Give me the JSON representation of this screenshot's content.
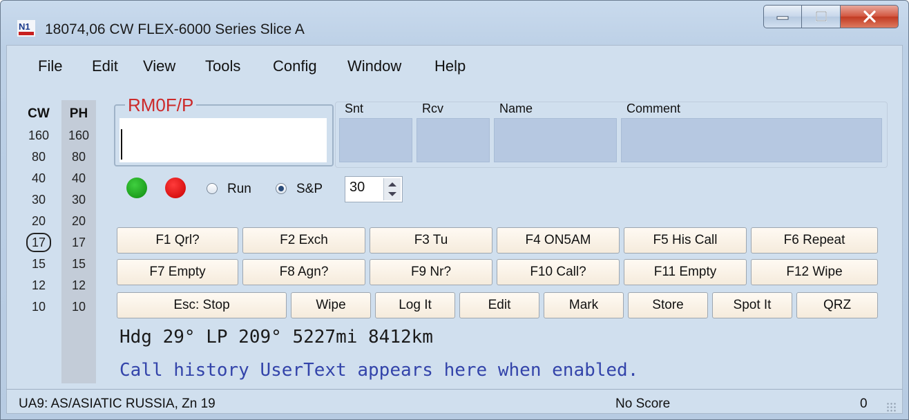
{
  "window": {
    "title": "18074,06 CW FLEX-6000 Series Slice A",
    "icon_text": "N1"
  },
  "menu": [
    "File",
    "Edit",
    "View",
    "Tools",
    "Config",
    "Window",
    "Help"
  ],
  "bands": {
    "cw_header": "CW",
    "ph_header": "PH",
    "cw": [
      "160",
      "80",
      "40",
      "30",
      "20",
      "17",
      "15",
      "12",
      "10"
    ],
    "ph": [
      "160",
      "80",
      "40",
      "30",
      "20",
      "17",
      "15",
      "12",
      "10"
    ],
    "selected": "17"
  },
  "entry": {
    "call_label": "RM0F/P",
    "call_value": "",
    "fields": {
      "snt": "Snt",
      "rcv": "Rcv",
      "name": "Name",
      "comment": "Comment"
    }
  },
  "mode": {
    "run_label": "Run",
    "sp_label": "S&P",
    "selected": "S&P",
    "spin_value": "30",
    "led_colors": [
      "#1aa61a",
      "#e00000"
    ]
  },
  "function_keys": [
    [
      "F1 Qrl?",
      "F2 Exch",
      "F3 Tu",
      "F4 ON5AM",
      "F5 His Call",
      "F6 Repeat"
    ],
    [
      "F7 Empty",
      "F8 Agn?",
      "F9 Nr?",
      "F10 Call?",
      "F11 Empty",
      "F12 Wipe"
    ]
  ],
  "action_keys": [
    "Esc: Stop",
    "Wipe",
    "Log It",
    "Edit",
    "Mark",
    "Store",
    "Spot It",
    "QRZ"
  ],
  "info": {
    "heading": "Hdg 29° LP 209° 5227mi 8412km",
    "call_history": "Call history UserText appears here when enabled."
  },
  "status": {
    "left": "UA9: AS/ASIATIC RUSSIA, Zn 19",
    "score": "No Score",
    "count": "0"
  },
  "colors": {
    "call_label": "#cc2a2a",
    "history_text": "#3344aa",
    "field_fill": "#b6c8e1"
  }
}
